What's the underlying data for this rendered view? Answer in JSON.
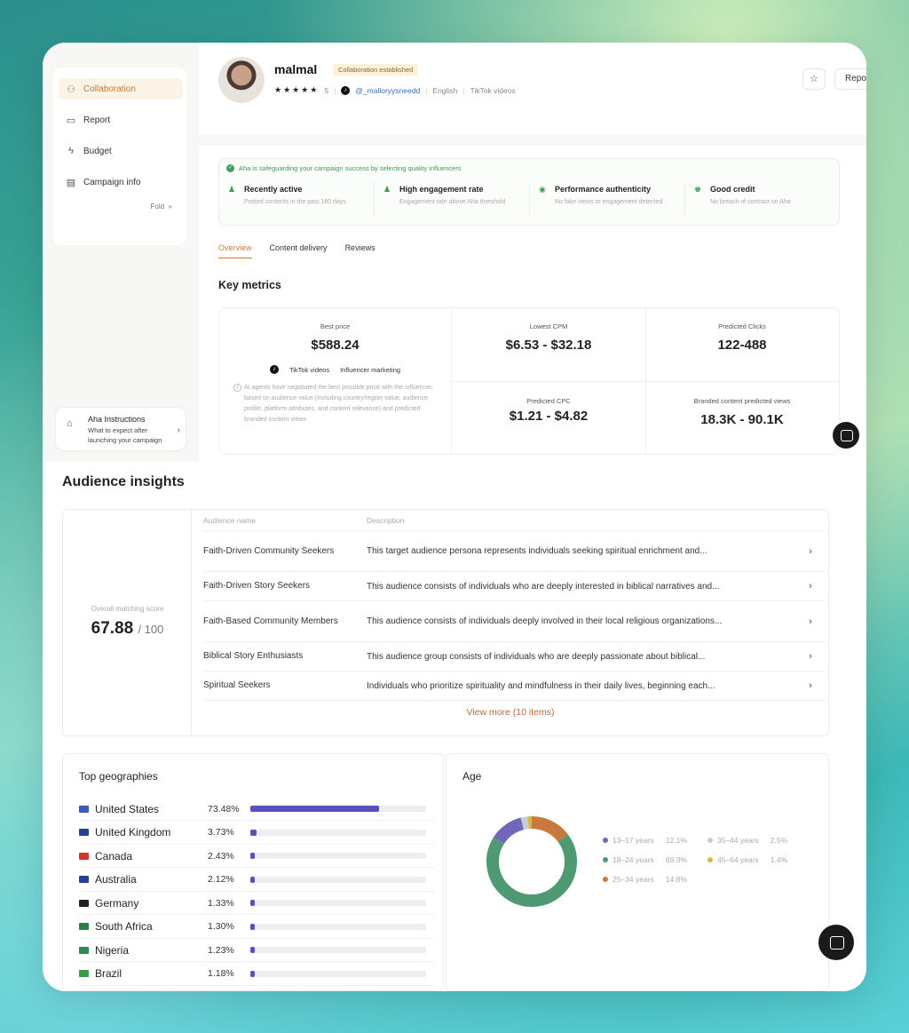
{
  "sidebar": {
    "items": [
      {
        "label": "Collaboration",
        "icon": "users-icon"
      },
      {
        "label": "Report",
        "icon": "monitor-icon"
      },
      {
        "label": "Budget",
        "icon": "bolt-icon"
      },
      {
        "label": "Campaign info",
        "icon": "document-icon"
      }
    ],
    "fold_label": "Fold",
    "fold_glyph": "«",
    "instructions": {
      "title": "Aha Instructions",
      "subtitle": "What to expect after launching your campaign"
    }
  },
  "profile": {
    "name": "malmal",
    "badge": "Collaboration established",
    "rating": "5",
    "handle": "@_malloryysneedd",
    "language": "English",
    "content_type": "TikTok videos",
    "report_label": "Report"
  },
  "guard": {
    "title": "Aha is safeguarding your campaign success by selecting quality influencers",
    "items": [
      {
        "title": "Recently active",
        "desc": "Posted contents in the past 180 days"
      },
      {
        "title": "High engagement rate",
        "desc": "Engagement rate above Aha threshold"
      },
      {
        "title": "Performance authenticity",
        "desc": "No fake views or engagement detected"
      },
      {
        "title": "Good credit",
        "desc": "No breach of contract on Aha"
      }
    ]
  },
  "tabs": [
    "Overview",
    "Content delivery",
    "Reviews"
  ],
  "key_metrics": {
    "title": "Key metrics",
    "best_price": {
      "label": "Best price",
      "value": "$588.24",
      "tags": [
        "TikTok videos",
        "Influencer marketing"
      ],
      "note": "AI agents have negotiated the best possible price with the influencer, based on audience value (including country/region value, audience profile, platform attributes, and content relevance) and predicted branded content views"
    },
    "lowest_cpm": {
      "label": "Lowest CPM",
      "value": "$6.53 - $32.18"
    },
    "predicted_clicks": {
      "label": "Predicted Clicks",
      "value": "122-488"
    },
    "predicted_cpc": {
      "label": "Predicted CPC",
      "value": "$1.21 - $4.82"
    },
    "branded_views": {
      "label": "Branded content predicted views",
      "value": "18.3K - 90.1K"
    }
  },
  "audience": {
    "title": "Audience insights",
    "score_label": "Overall matching score",
    "score_value": "67.88",
    "score_max": "/ 100",
    "headers": {
      "name": "Audience name",
      "desc": "Description"
    },
    "rows": [
      {
        "name": "Faith-Driven Community Seekers",
        "desc": "This target audience persona represents individuals seeking spiritual enrichment and..."
      },
      {
        "name": "Faith-Driven Story Seekers",
        "desc": "This audience consists of individuals who are deeply interested in biblical narratives and..."
      },
      {
        "name": "Faith-Based Community Members",
        "desc": "This audience consists of individuals deeply involved in their local religious organizations..."
      },
      {
        "name": "Biblical Story Enthusiasts",
        "desc": "This audience group consists of individuals who are deeply passionate about biblical..."
      },
      {
        "name": "Spiritual Seekers",
        "desc": "Individuals who prioritize spirituality and mindfulness in their daily lives, beginning each..."
      }
    ],
    "view_more": "View more (10 items)"
  },
  "geographies": {
    "title": "Top geographies",
    "rows": [
      {
        "country": "United States",
        "pct": "73.48%",
        "value": 73.48,
        "flag_color": "#3b5bb5"
      },
      {
        "country": "United Kingdom",
        "pct": "3.73%",
        "value": 3.73,
        "flag_color": "#2a3f8f"
      },
      {
        "country": "Canada",
        "pct": "2.43%",
        "value": 2.43,
        "flag_color": "#d8322f"
      },
      {
        "country": "Australia",
        "pct": "2.12%",
        "value": 2.12,
        "flag_color": "#2a3f8f"
      },
      {
        "country": "Germany",
        "pct": "1.33%",
        "value": 1.33,
        "flag_color": "#222222"
      },
      {
        "country": "South Africa",
        "pct": "1.30%",
        "value": 1.3,
        "flag_color": "#2e7d4a"
      },
      {
        "country": "Nigeria",
        "pct": "1.23%",
        "value": 1.23,
        "flag_color": "#2e8b57"
      },
      {
        "country": "Brazil",
        "pct": "1.18%",
        "value": 1.18,
        "flag_color": "#3a9a4a"
      }
    ]
  },
  "chart_data": {
    "type": "pie",
    "title": "Age",
    "categories": [
      "13-17 years",
      "18-24 years",
      "25-34 years",
      "35-44 years",
      "45-64 years"
    ],
    "labels": [
      "13–17 years",
      "18–24 years",
      "25–34 years",
      "35–44 years",
      "45–64 years"
    ],
    "pct_labels": [
      "12.1%",
      "69.3%",
      "14.8%",
      "2.5%",
      "1.4%"
    ],
    "values": [
      12.1,
      69.3,
      14.8,
      2.5,
      1.4
    ],
    "colors": [
      "#6f68b8",
      "#4f9a72",
      "#c87a3c",
      "#c9ccd4",
      "#d6b64a"
    ],
    "legend_placement": "right"
  }
}
